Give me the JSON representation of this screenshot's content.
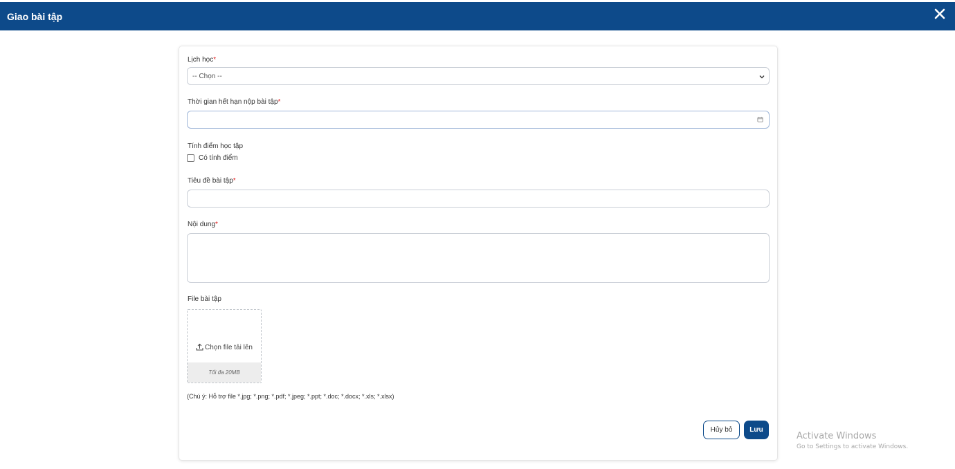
{
  "header": {
    "title": "Giao bài tập",
    "close_icon": "close-icon",
    "background": "#0d4a8a"
  },
  "form": {
    "schedule": {
      "label": "Lịch học",
      "required_mark": "*",
      "selected": "-- Chọn --"
    },
    "deadline": {
      "label": "Thời gian hết hạn nộp bài tập",
      "required_mark": "*",
      "value": "",
      "icon": "calendar-icon"
    },
    "grading": {
      "label": "Tính điểm học tập",
      "checkbox_label": "Có tính điểm",
      "checked": false
    },
    "title": {
      "label": "Tiêu đề bài tập",
      "required_mark": "*",
      "value": ""
    },
    "content": {
      "label": "Nội dung",
      "required_mark": "*",
      "value": ""
    },
    "file": {
      "label": "File bài tập",
      "upload_label": "Chọn file tải lên",
      "upload_icon": "upload-icon",
      "max_size": "Tối đa 20MB",
      "note": "(Chú ý: Hỗ trợ file *.jpg; *.png; *.pdf; *.jpeg; *.ppt; *.doc; *.docx; *.xls; *.xlsx)"
    }
  },
  "actions": {
    "cancel_label": "Hủy bỏ",
    "save_label": "Lưu"
  },
  "watermark": {
    "line1": "Activate Windows",
    "line2": "Go to Settings to activate Windows."
  },
  "colors": {
    "accent": "#0d4a8a",
    "required": "#e02020"
  }
}
